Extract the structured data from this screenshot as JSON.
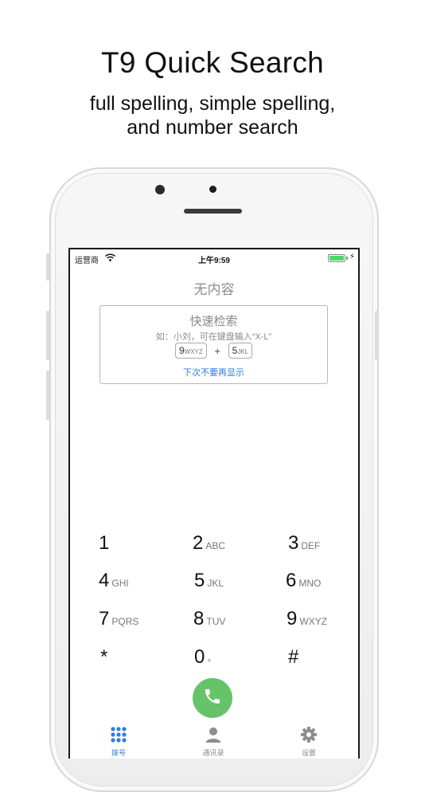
{
  "header": {
    "title": "T9 Quick Search",
    "subtitle_line1": "full spelling, simple spelling,",
    "subtitle_line2": "and number search"
  },
  "status_bar": {
    "carrier": "运营商",
    "time": "上午9:59"
  },
  "main": {
    "empty_title": "无内容",
    "tip": {
      "title": "快速检索",
      "example": "如：小刘，可在键盘输入“X-L”",
      "key1_digit": "9",
      "key1_letters": "WXYZ",
      "plus": "+",
      "key2_digit": "5",
      "key2_letters": "JKL",
      "dismiss_link": "下次不要再显示"
    }
  },
  "dialpad": {
    "keys": [
      {
        "digit": "1",
        "letters": ""
      },
      {
        "digit": "2",
        "letters": "ABC"
      },
      {
        "digit": "3",
        "letters": "DEF"
      },
      {
        "digit": "4",
        "letters": "GHI"
      },
      {
        "digit": "5",
        "letters": "JKL"
      },
      {
        "digit": "6",
        "letters": "MNO"
      },
      {
        "digit": "7",
        "letters": "PQRS"
      },
      {
        "digit": "8",
        "letters": "TUV"
      },
      {
        "digit": "9",
        "letters": "WXYZ"
      },
      {
        "digit": "*",
        "letters": ""
      },
      {
        "digit": "0",
        "letters": "+"
      },
      {
        "digit": "#",
        "letters": ""
      }
    ],
    "call_icon": "phone-icon"
  },
  "tabbar": {
    "dial_label": "拨号",
    "contacts_label": "通讯录",
    "settings_label": "设置"
  },
  "colors": {
    "accent": "#2f7de1",
    "call_green": "#67c36a",
    "battery_green": "#4cd964"
  }
}
